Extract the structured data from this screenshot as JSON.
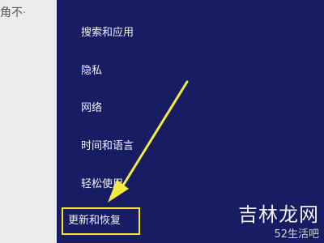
{
  "background_fragment": {
    "text": "角不",
    "suffix": "·"
  },
  "menu": {
    "items": [
      {
        "label": "搜索和应用"
      },
      {
        "label": "隐私"
      },
      {
        "label": "网络"
      },
      {
        "label": "时间和语言"
      },
      {
        "label": "轻松使用"
      },
      {
        "label": "更新和恢复"
      }
    ],
    "selected_index": 5
  },
  "watermark": {
    "title": "吉林龙网",
    "subtitle": "52生活吧"
  },
  "colors": {
    "panel_bg": "#181c63",
    "highlight": "#f1e633",
    "menu_text": "#f2f2f2"
  },
  "icons": {
    "annotation_arrow": "arrow-pointing-down-left"
  }
}
